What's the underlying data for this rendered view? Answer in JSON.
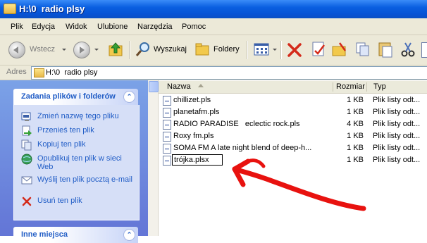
{
  "window": {
    "title": "H:\\0  radio plsy"
  },
  "menu": [
    "Plik",
    "Edycja",
    "Widok",
    "Ulubione",
    "Narzędzia",
    "Pomoc"
  ],
  "toolbar": {
    "back_label": "Wstecz",
    "search_label": "Wyszukaj",
    "folders_label": "Foldery"
  },
  "address": {
    "label": "Adres",
    "value": "H:\\0  radio plsy"
  },
  "tasks": {
    "file_tasks_title": "Zadania plików i folderów",
    "items": [
      "Zmień nazwę tego pliku",
      "Przenieś ten plik",
      "Kopiuj ten plik",
      "Opublikuj ten plik w sieci Web",
      "Wyślij ten plik pocztą e-mail",
      "Usuń ten plik"
    ],
    "other_places_title": "Inne miejsca"
  },
  "columns": {
    "name": "Nazwa",
    "size": "Rozmiar",
    "type": "Typ"
  },
  "files": [
    {
      "name": "chillizet.pls",
      "size": "1 KB",
      "type": "Plik listy odt..."
    },
    {
      "name": "planetafm.pls",
      "size": "1 KB",
      "type": "Plik listy odt..."
    },
    {
      "name": "RADIO PARADISE   eclectic rock.pls",
      "size": "4 KB",
      "type": "Plik listy odt..."
    },
    {
      "name": "Roxy fm.pls",
      "size": "1 KB",
      "type": "Plik listy odt..."
    },
    {
      "name": "SOMA FM A late night blend of deep-h...",
      "size": "1 KB",
      "type": "Plik listy odt..."
    },
    {
      "name": "trójka.plsx",
      "size": "1 KB",
      "type": "Plik listy odt..."
    }
  ],
  "colors": {
    "titlebar": "#0a5fe0",
    "annotation_arrow": "#e8120f",
    "link": "#215dc6"
  }
}
